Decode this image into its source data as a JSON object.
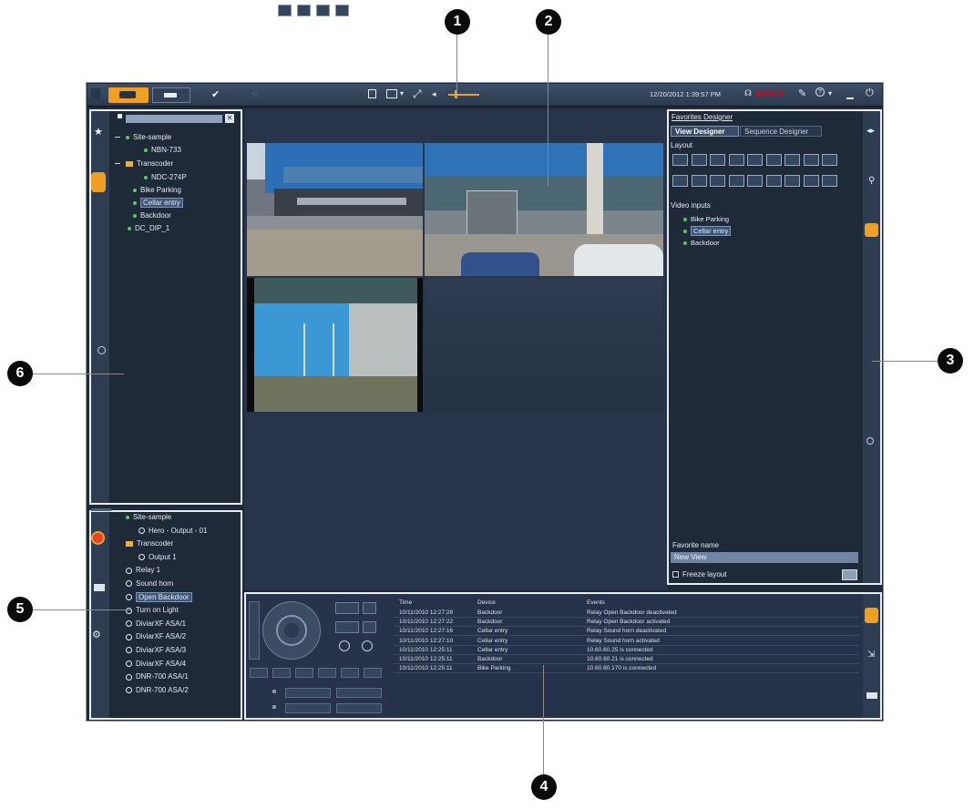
{
  "topbar": {
    "datetime": "12/20/2012 1:39:57 PM",
    "brand": "BOSCH"
  },
  "logical_tree": {
    "items": [
      {
        "label": "Site-sample",
        "kind": "site"
      },
      {
        "label": "NBN-733",
        "kind": "camera"
      },
      {
        "label": "Transcoder",
        "kind": "folder"
      },
      {
        "label": "NDC-274P",
        "kind": "camera"
      },
      {
        "label": "Bike Parking",
        "kind": "camera"
      },
      {
        "label": "Cellar entry",
        "kind": "camera",
        "selected": true
      },
      {
        "label": "Backdoor",
        "kind": "camera"
      },
      {
        "label": "DC_DIP_1",
        "kind": "camera"
      }
    ]
  },
  "relay_tree": {
    "items": [
      {
        "label": "Site-sample",
        "kind": "site"
      },
      {
        "label": "Hero - Output - 01",
        "kind": "output"
      },
      {
        "label": "Transcoder",
        "kind": "folder"
      },
      {
        "label": "Output 1",
        "kind": "output"
      },
      {
        "label": "Relay 1",
        "kind": "output"
      },
      {
        "label": "Sound horn",
        "kind": "output"
      },
      {
        "label": "Open Backdoor",
        "kind": "output",
        "selected": true
      },
      {
        "label": "Turn on Light",
        "kind": "output"
      },
      {
        "label": "DiviarXF ASA/1",
        "kind": "output"
      },
      {
        "label": "DiviarXF ASA/2",
        "kind": "output"
      },
      {
        "label": "DiviarXF ASA/3",
        "kind": "output"
      },
      {
        "label": "DiviarXF ASA/4",
        "kind": "output"
      },
      {
        "label": "DNR-700 ASA/1",
        "kind": "output"
      },
      {
        "label": "DNR-700 ASA/2",
        "kind": "output"
      }
    ]
  },
  "favorites_designer": {
    "title": "Favorites Designer",
    "tabs": [
      "View Designer",
      "Sequence Designer"
    ],
    "layout_label": "Layout",
    "video_inputs_label": "Video inputs",
    "video_inputs": [
      {
        "label": "Bike Parking"
      },
      {
        "label": "Cellar entry",
        "selected": true
      },
      {
        "label": "Backdoor"
      }
    ],
    "favorite_name_label": "Favorite name",
    "favorite_name_value": "New View",
    "freeze_layout_label": "Freeze layout"
  },
  "event_log": {
    "headers": [
      "Time",
      "Device",
      "Events"
    ],
    "rows": [
      {
        "time": "10/11/2010 12:27:28",
        "device": "Backdoor",
        "event": "Relay Open Backdoor deactivated"
      },
      {
        "time": "10/11/2010 12:27:22",
        "device": "Backdoor",
        "event": "Relay Open Backdoor activated"
      },
      {
        "time": "10/11/2010 12:27:16",
        "device": "Cellar entry",
        "event": "Relay Sound horn deactivated"
      },
      {
        "time": "10/11/2010 12:27:10",
        "device": "Cellar entry",
        "event": "Relay Sound horn activated"
      },
      {
        "time": "10/11/2010 12:25:11",
        "device": "Cellar entry",
        "event": "10.60.60.25 is connected"
      },
      {
        "time": "10/11/2010 12:25:11",
        "device": "Backdoor",
        "event": "10.60.60.21 is connected"
      },
      {
        "time": "10/11/2010 12:25:11",
        "device": "Bike Parking",
        "event": "10.60.60.170 is connected"
      }
    ]
  },
  "callouts": [
    "1",
    "2",
    "3",
    "4",
    "5",
    "6"
  ],
  "colors": {
    "window_bg": "#1f2a39",
    "panel_bg": "#26334a",
    "accent_orange": "#f0a020",
    "brand_red": "#e1001b",
    "online_green": "#4fcf55"
  }
}
